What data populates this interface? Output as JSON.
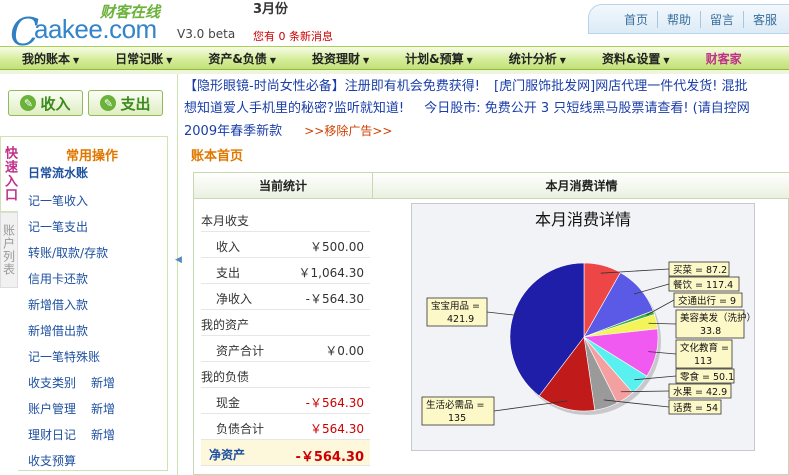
{
  "header": {
    "logo_domain": "aakee.com",
    "logo_tagline": "财客在线",
    "version": "V3.0 beta",
    "month": "3月份",
    "message_prefix": "您有",
    "message_count": "0",
    "message_suffix": "条新消息",
    "top_links": [
      "首页",
      "帮助",
      "留言",
      "客服"
    ]
  },
  "nav": {
    "items": [
      "我的账本",
      "日常记账",
      "资产&负债",
      "投资理财",
      "计划&预算",
      "统计分析",
      "资料&设置"
    ],
    "special": "财客家"
  },
  "left": {
    "income_button": "收入",
    "expense_button": "支出",
    "tab_quick": "快速入口",
    "tab_accounts": "账户列表",
    "ops_title": "常用操作",
    "ops_subtitle": "日常流水账",
    "links": [
      "记一笔收入",
      "记一笔支出",
      "转账/取款/存款",
      "信用卡还款",
      "新增借入款",
      "新增借出款",
      "记一笔特殊账"
    ],
    "links_with_add": [
      {
        "label": "收支类别",
        "add": "新增"
      },
      {
        "label": "账户管理",
        "add": "新增"
      },
      {
        "label": "理财日记",
        "add": "新增"
      }
    ],
    "last_link": "收支预算"
  },
  "ads": {
    "line1_a": "【隐形眼镜-时尚女性必备】注册即有机会免费获得!",
    "line1_b": "[虎门服饰批发网]网店代理一件代发货! 混批",
    "line2_a": "想知道爱人手机里的秘密?监听就知道!",
    "line2_b": "今日股市: 免费公开 3 只短线黑马股票请查看! (请自控网",
    "line3_a": "2009年春季新款",
    "remove_ads": ">>移除广告>>"
  },
  "main": {
    "breadcrumb": "账本首页",
    "col1_header": "当前统计",
    "col2_header": "本月消费详情",
    "stats": {
      "income_section": "本月收支",
      "income_label": "收入",
      "income_value": "￥500.00",
      "expense_label": "支出",
      "expense_value": "￥1,064.30",
      "net_income_label": "净收入",
      "net_income_value": "-￥564.30",
      "assets_section": "我的资产",
      "assets_total_label": "资产合计",
      "assets_total_value": "￥0.00",
      "liab_section": "我的负债",
      "cash_label": "现金",
      "cash_value": "-￥564.30",
      "liab_total_label": "负债合计",
      "liab_total_value": "￥564.30",
      "net_assets_label": "净资产",
      "net_assets_value": "-￥564.30"
    }
  },
  "chart_data": {
    "type": "pie",
    "title": "本月消费详情",
    "slices": [
      {
        "label": "买菜 = 87.2",
        "value": 87.2,
        "color": "#ee4646"
      },
      {
        "label": "餐饮 = 117.4",
        "value": 117.4,
        "color": "#5a5ae6"
      },
      {
        "label": "交通出行 = 9",
        "value": 9,
        "color": "#3cb33c"
      },
      {
        "label": "美容美发（洗护）= 33.8",
        "value": 33.8,
        "color": "#f3f35a"
      },
      {
        "label": "文化教育 = 113",
        "value": 113,
        "color": "#f05af0"
      },
      {
        "label": "零食 = 50.1",
        "value": 50.1,
        "color": "#5af0f0"
      },
      {
        "label": "水果 = 42.9",
        "value": 42.9,
        "color": "#f5a0a0"
      },
      {
        "label": "话费 = 54",
        "value": 54,
        "color": "#9a9a9a"
      },
      {
        "label": "生活必需品 = 135",
        "value": 135,
        "color": "#c01a1a"
      },
      {
        "label": "宝宝用品 = 421.9",
        "value": 421.9,
        "color": "#1e1ea8"
      }
    ]
  }
}
